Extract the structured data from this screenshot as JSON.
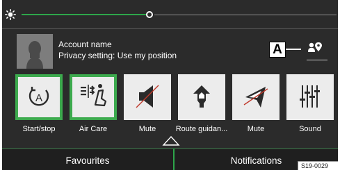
{
  "brightness": {
    "icon": "sun-icon",
    "level_fraction": 0.41
  },
  "account": {
    "name": "Account name",
    "privacy": "Privacy setting: Use my position",
    "avatar_icon": "person-silhouette-icon",
    "location_icon": "person-location-pin-icon"
  },
  "callout": "A",
  "tiles": [
    {
      "label": "Start/stop",
      "icon": "auto-start-stop-icon",
      "active": true
    },
    {
      "label": "Air Care",
      "icon": "air-care-icon",
      "active": true
    },
    {
      "label": "Mute",
      "icon": "speaker-mute-icon",
      "active": false
    },
    {
      "label": "Route guidan...",
      "icon": "route-guidance-icon",
      "active": false
    },
    {
      "label": "Mute",
      "icon": "navigation-mute-icon",
      "active": false
    },
    {
      "label": "Sound",
      "icon": "equalizer-sliders-icon",
      "active": false
    }
  ],
  "tabs": {
    "favourites": "Favourites",
    "notifications": "Notifications"
  },
  "expand_icon": "up-triangle-icon",
  "figure_code": "S19-0029",
  "colors": {
    "accent": "#3daa4e",
    "panel": "#2b2b2b",
    "tile": "#ececec",
    "tab": "#1f1f1f"
  }
}
